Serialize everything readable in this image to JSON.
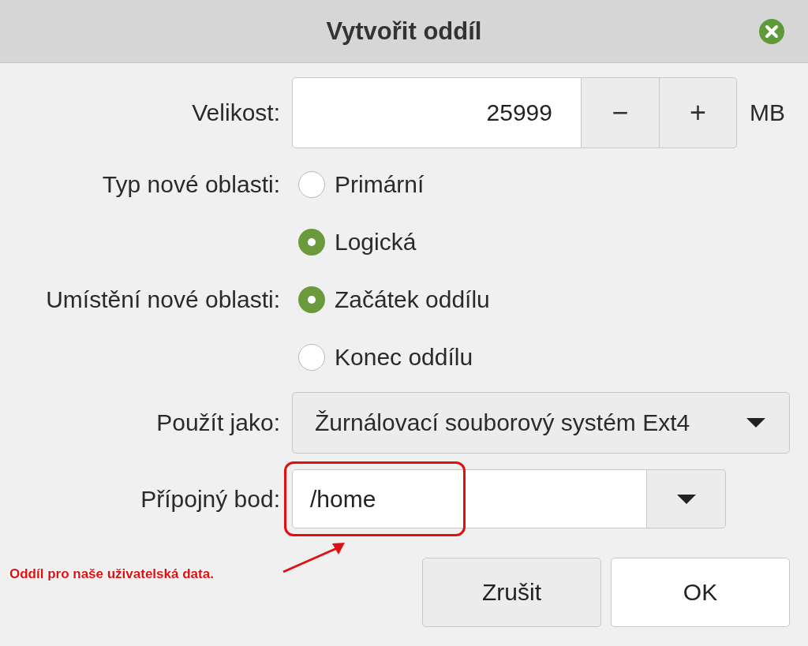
{
  "window": {
    "title": "Vytvořit oddíl"
  },
  "size": {
    "label": "Velikost:",
    "value": "25999",
    "decrement": "−",
    "increment": "+",
    "unit": "MB"
  },
  "partition_type": {
    "label": "Typ nové oblasti:",
    "options": [
      {
        "label": "Primární",
        "selected": false
      },
      {
        "label": "Logická",
        "selected": true
      }
    ]
  },
  "location": {
    "label": "Umístění nové oblasti:",
    "options": [
      {
        "label": "Začátek oddílu",
        "selected": true
      },
      {
        "label": "Konec oddílu",
        "selected": false
      }
    ]
  },
  "use_as": {
    "label": "Použít jako:",
    "value": "Žurnálovací souborový systém Ext4"
  },
  "mount_point": {
    "label": "Přípojný bod:",
    "value": "/home"
  },
  "buttons": [
    "Zrušit",
    "OK"
  ],
  "annotation": {
    "text": "Oddíl pro naše uživatelská data."
  }
}
